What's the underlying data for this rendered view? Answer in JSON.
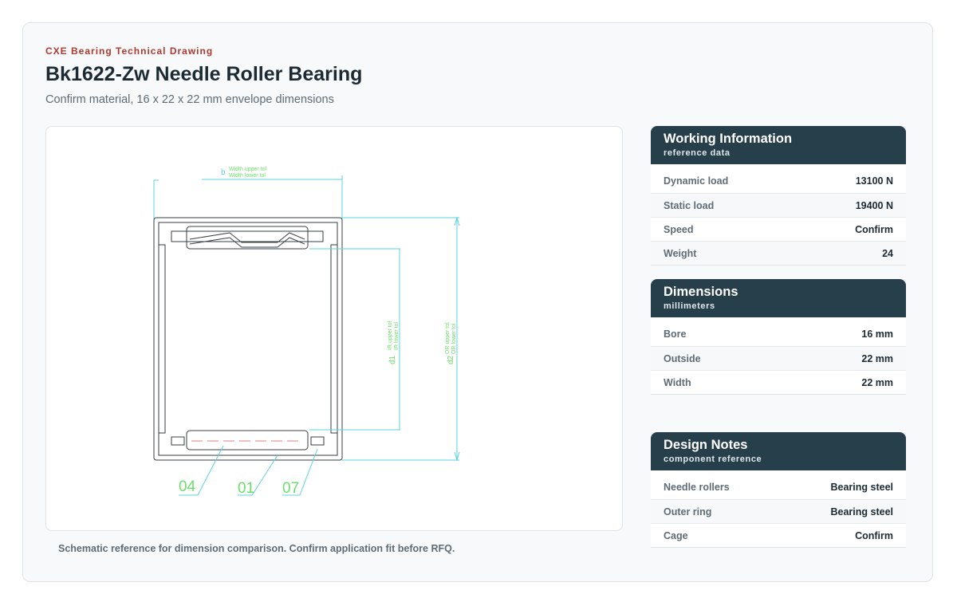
{
  "header": {
    "eyebrow": "CXE Bearing Technical Drawing",
    "title": "Bk1622-Zw Needle Roller Bearing",
    "subtitle": "Confirm material, 16 x 22 x 22 mm envelope dimensions"
  },
  "drawing": {
    "width_label": "b",
    "width_tol_upper": "Width upper tol",
    "width_tol_lower": "Width lower tol",
    "d1_label": "d1",
    "d1_tol_upper": "IR upper tol",
    "d1_tol_lower": "IR lower tol",
    "d2_label": "d2",
    "d2_tol_upper": "OR upper tol",
    "d2_tol_lower": "OR lower tol",
    "callouts": [
      "04",
      "01",
      "07"
    ],
    "colors": {
      "outline": "#3a3f44",
      "dimension": "#5fd3e0",
      "label": "#6be06b",
      "centerline": "#e08080"
    }
  },
  "caption": "Schematic reference for dimension comparison. Confirm application fit before RFQ.",
  "panels": {
    "working": {
      "title": "Working Information",
      "subtitle": "reference data",
      "rows": [
        {
          "label": "Dynamic load",
          "value": "13100 N"
        },
        {
          "label": "Static load",
          "value": "19400 N"
        },
        {
          "label": "Speed",
          "value": "Confirm"
        },
        {
          "label": "Weight",
          "value": "24"
        }
      ]
    },
    "dimensions": {
      "title": "Dimensions",
      "subtitle": "millimeters",
      "rows": [
        {
          "label": "Bore",
          "value": "16 mm"
        },
        {
          "label": "Outside",
          "value": "22 mm"
        },
        {
          "label": "Width",
          "value": "22 mm"
        }
      ]
    },
    "design": {
      "title": "Design Notes",
      "subtitle": "component reference",
      "rows": [
        {
          "label": "Needle rollers",
          "value": "Bearing steel"
        },
        {
          "label": "Outer ring",
          "value": "Bearing steel"
        },
        {
          "label": "Cage",
          "value": "Confirm"
        }
      ]
    }
  },
  "colors": {
    "accent": "#b0392e",
    "panel_header": "#263f4b"
  }
}
